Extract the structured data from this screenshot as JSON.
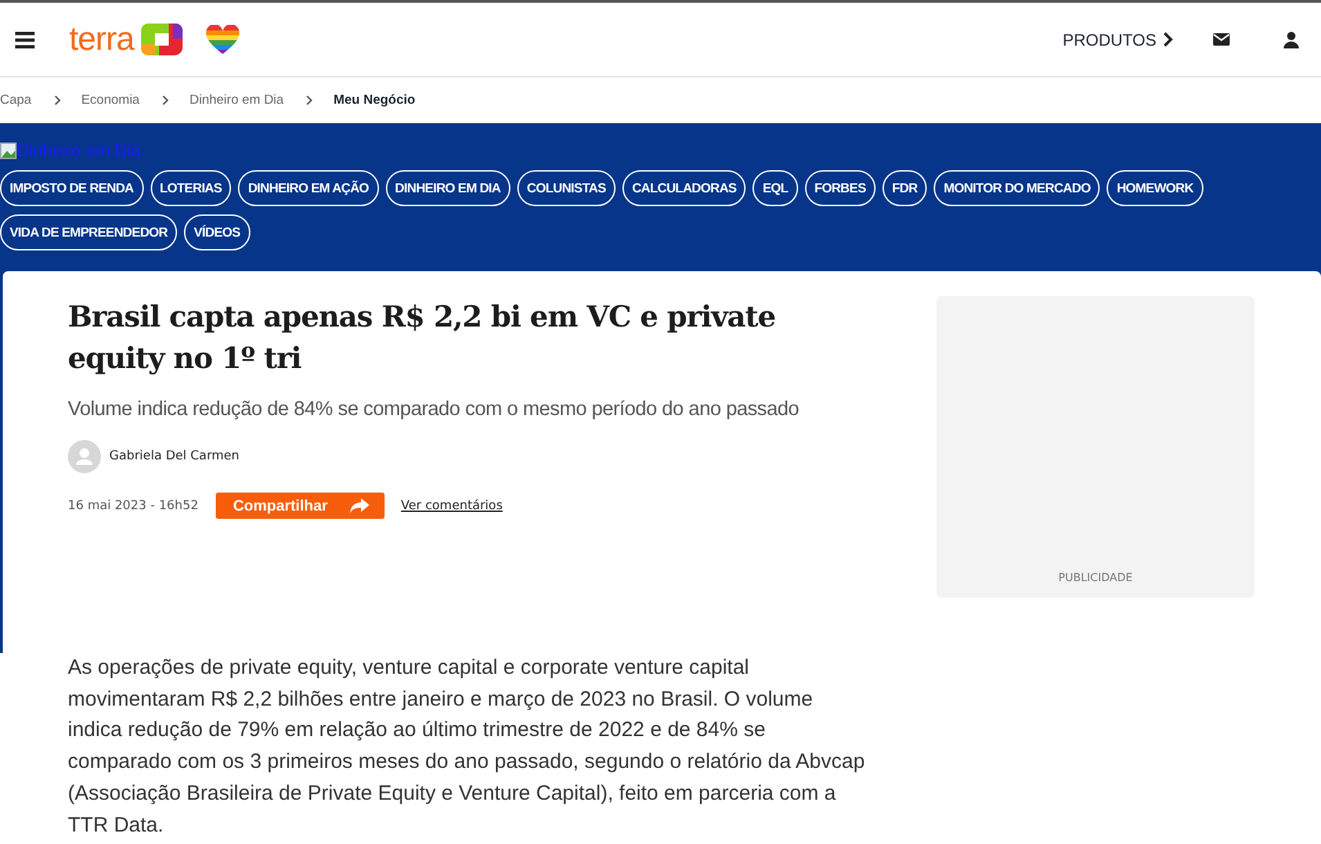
{
  "header": {
    "logo_text": "terra",
    "products_label": "PRODUTOS"
  },
  "breadcrumb": [
    {
      "label": "Capa",
      "current": false
    },
    {
      "label": "Economia",
      "current": false
    },
    {
      "label": "Dinheiro em Dia",
      "current": false
    },
    {
      "label": "Meu Negócio",
      "current": true
    }
  ],
  "section_image_alt": "Dinheiro em Dia",
  "nav_chips": [
    "IMPOSTO DE RENDA",
    "LOTERIAS",
    "DINHEIRO EM AÇÃO",
    "DINHEIRO EM DIA",
    "COLUNISTAS",
    "CALCULADORAS",
    "EQL",
    "FORBES",
    "FDR",
    "MONITOR DO MERCADO",
    "HOMEWORK",
    "VIDA DE EMPREENDEDOR",
    "VÍDEOS"
  ],
  "article": {
    "title": "Brasil capta apenas R$ 2,2 bi em VC e private equity no 1º tri",
    "subtitle": "Volume indica redução de 84% se comparado com o mesmo período do ano passado",
    "author": "Gabriela Del Carmen",
    "date": "16 mai 2023 - 16h52",
    "share_label": "Compartilhar",
    "comments_link": "Ver comentários",
    "body": "As operações de private equity, venture capital e corporate venture capital movimentaram R$ 2,2 bilhões entre janeiro e março de 2023 no Brasil. O volume indica redução de 79% em relação ao último trimestre de 2022 e de 84% se comparado com os 3 primeiros meses do ano passado, segundo o relatório da Abvcap (Associação Brasileira de Private Equity e Venture Capital), feito em parceria com a TTR Data."
  },
  "ad": {
    "label": "PUBLICIDADE"
  }
}
